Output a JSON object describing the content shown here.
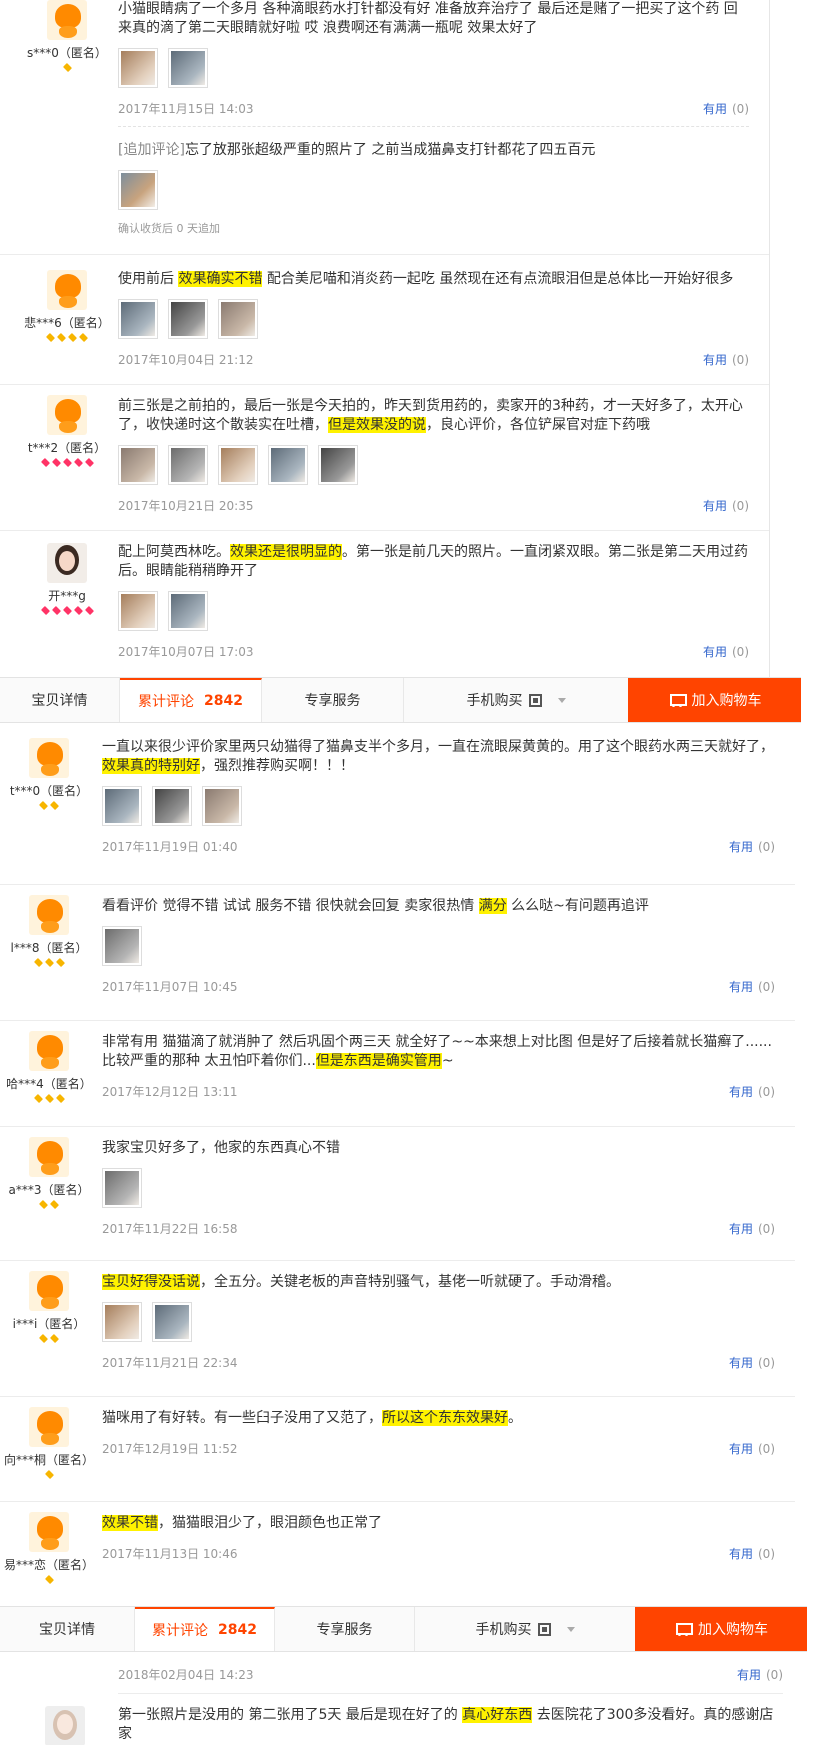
{
  "colors": {
    "accent": "#ff4400",
    "highlight": "#fff200",
    "useful_link": "#3366cc",
    "rank_gold": "#f7b500",
    "rank_red": "#ff3366"
  },
  "useful_label": "有用",
  "useful_count": "(0)",
  "tabs": {
    "details": "宝贝详情",
    "reviews": "累计评论",
    "reviews_count": "2842",
    "service": "专享服务",
    "mobile_buy": "手机购买",
    "add_to_cart": "加入购物车"
  },
  "panel_a": {
    "reviews": [
      {
        "user": "s***0（匿名）",
        "avatar": "orange-avatar",
        "rank_type": "gold",
        "rank_count": 1,
        "segments": [
          {
            "t": "小猫眼睛病了一个多月 各种滴眼药水打针都没有好 准备放弃治疗了 最后还是赌了一把买了这个药 回来真的滴了第二天眼睛就好啦 哎 浪费啊还有满满一瓶呢 效果太好了",
            "h": false
          }
        ],
        "photos": 2,
        "date": "2017年11月15日 14:03",
        "followup": {
          "label": "[追加评论]",
          "text": "忘了放那张超级严重的照片了 之前当成猫鼻支打针都花了四五百元",
          "photos": 1,
          "confirm": "确认收货后 0 天追加"
        }
      },
      {
        "user": "悲***6（匿名）",
        "avatar": "orange-avatar",
        "rank_type": "gold",
        "rank_count": 4,
        "segments": [
          {
            "t": "使用前后 ",
            "h": false
          },
          {
            "t": "效果确实不错",
            "h": true
          },
          {
            "t": " 配合美尼喵和消炎药一起吃 虽然现在还有点流眼泪但是总体比一开始好很多",
            "h": false
          }
        ],
        "photos": 3,
        "date": "2017年10月04日 21:12"
      },
      {
        "user": "t***2（匿名）",
        "avatar": "orange-avatar",
        "rank_type": "red",
        "rank_count": 5,
        "segments": [
          {
            "t": "前三张是之前拍的，最后一张是今天拍的，昨天到货用药的，卖家开的3种药，才一天好多了，太开心了，收快递时这个散装实在吐槽，",
            "h": false
          },
          {
            "t": "但是效果没的说",
            "h": true
          },
          {
            "t": "，良心评价，各位铲屎官对症下药哦",
            "h": false
          }
        ],
        "photos": 5,
        "date": "2017年10月21日 20:35"
      },
      {
        "user": "开***g",
        "avatar": "girl-avatar",
        "rank_type": "red",
        "rank_count": 5,
        "segments": [
          {
            "t": "配上阿莫西林吃。",
            "h": false
          },
          {
            "t": "效果还是很明显的",
            "h": true
          },
          {
            "t": "。第一张是前几天的照片。一直闭紧双眼。第二张是第二天用过药后。眼睛能稍稍睁开了",
            "h": false
          }
        ],
        "photos": 2,
        "date": "2017年10月07日 17:03"
      }
    ]
  },
  "panel_b": {
    "reviews": [
      {
        "user": "t***0（匿名）",
        "avatar": "orange-avatar",
        "rank_type": "gold",
        "rank_count": 2,
        "segments": [
          {
            "t": "一直以来很少评价家里两只幼猫得了猫鼻支半个多月，一直在流眼屎黄黄的。用了这个眼药水两三天就好了，",
            "h": false
          },
          {
            "t": "效果真的特别好",
            "h": true
          },
          {
            "t": "，强烈推荐购买啊！！！",
            "h": false
          }
        ],
        "photos": 3,
        "date": "2017年11月19日 01:40"
      },
      {
        "user": "l***8（匿名）",
        "avatar": "orange-avatar",
        "rank_type": "gold",
        "rank_count": 3,
        "segments": [
          {
            "t": "看看评价 觉得不错 试试 服务不错 很快就会回复 卖家很热情 ",
            "h": false
          },
          {
            "t": "满分",
            "h": true
          },
          {
            "t": " 么么哒~有问题再追评",
            "h": false
          }
        ],
        "photos": 1,
        "date": "2017年11月07日 10:45"
      },
      {
        "user": "哈***4（匿名）",
        "avatar": "orange-avatar",
        "rank_type": "gold",
        "rank_count": 3,
        "segments": [
          {
            "t": "非常有用 猫猫滴了就消肿了 然后巩固个两三天 就全好了~~本来想上对比图 但是好了后接着就长猫癣了......比较严重的那种 太丑怕吓着你们...",
            "h": false
          },
          {
            "t": "但是东西是确实管用",
            "h": true
          },
          {
            "t": "~",
            "h": false
          }
        ],
        "photos": 0,
        "date": "2017年12月12日 13:11"
      },
      {
        "user": "a***3（匿名）",
        "avatar": "orange-avatar",
        "rank_type": "gold",
        "rank_count": 2,
        "segments": [
          {
            "t": "我家宝贝好多了，他家的东西真心不错",
            "h": false
          }
        ],
        "photos": 1,
        "date": "2017年11月22日 16:58"
      },
      {
        "user": "i***i（匿名）",
        "avatar": "orange-avatar",
        "rank_type": "gold",
        "rank_count": 2,
        "segments": [
          {
            "t": "宝贝好得没话说",
            "h": true
          },
          {
            "t": "，全五分。关键老板的声音特别骚气，基佬一听就硬了。手动滑稽。",
            "h": false
          }
        ],
        "photos": 2,
        "date": "2017年11月21日 22:34"
      },
      {
        "user": "向***桐（匿名）",
        "avatar": "orange-avatar",
        "rank_type": "gold",
        "rank_count": 1,
        "segments": [
          {
            "t": "猫咪用了有好转。有一些臼子没用了又范了，",
            "h": false
          },
          {
            "t": "所以这个东东效果好",
            "h": true
          },
          {
            "t": "。",
            "h": false
          }
        ],
        "photos": 0,
        "date": "2017年12月19日 11:52"
      },
      {
        "user": "易***恋（匿名）",
        "avatar": "orange-avatar",
        "rank_type": "gold",
        "rank_count": 1,
        "segments": [
          {
            "t": "效果不错",
            "h": true
          },
          {
            "t": "，猫猫眼泪少了，眼泪颜色也正常了",
            "h": false
          }
        ],
        "photos": 0,
        "date": "2017年11月13日 10:46"
      }
    ]
  },
  "panel_c": {
    "top_date": "2018年02月04日 14:23",
    "review": {
      "avatar": "woman-avatar",
      "segments": [
        {
          "t": "第一张照片是没用的 第二张用了5天 最后是现在好了的 ",
          "h": false
        },
        {
          "t": "真心好东西",
          "h": true
        },
        {
          "t": " 去医院花了300多没看好。真的感谢店家",
          "h": false
        }
      ]
    }
  }
}
